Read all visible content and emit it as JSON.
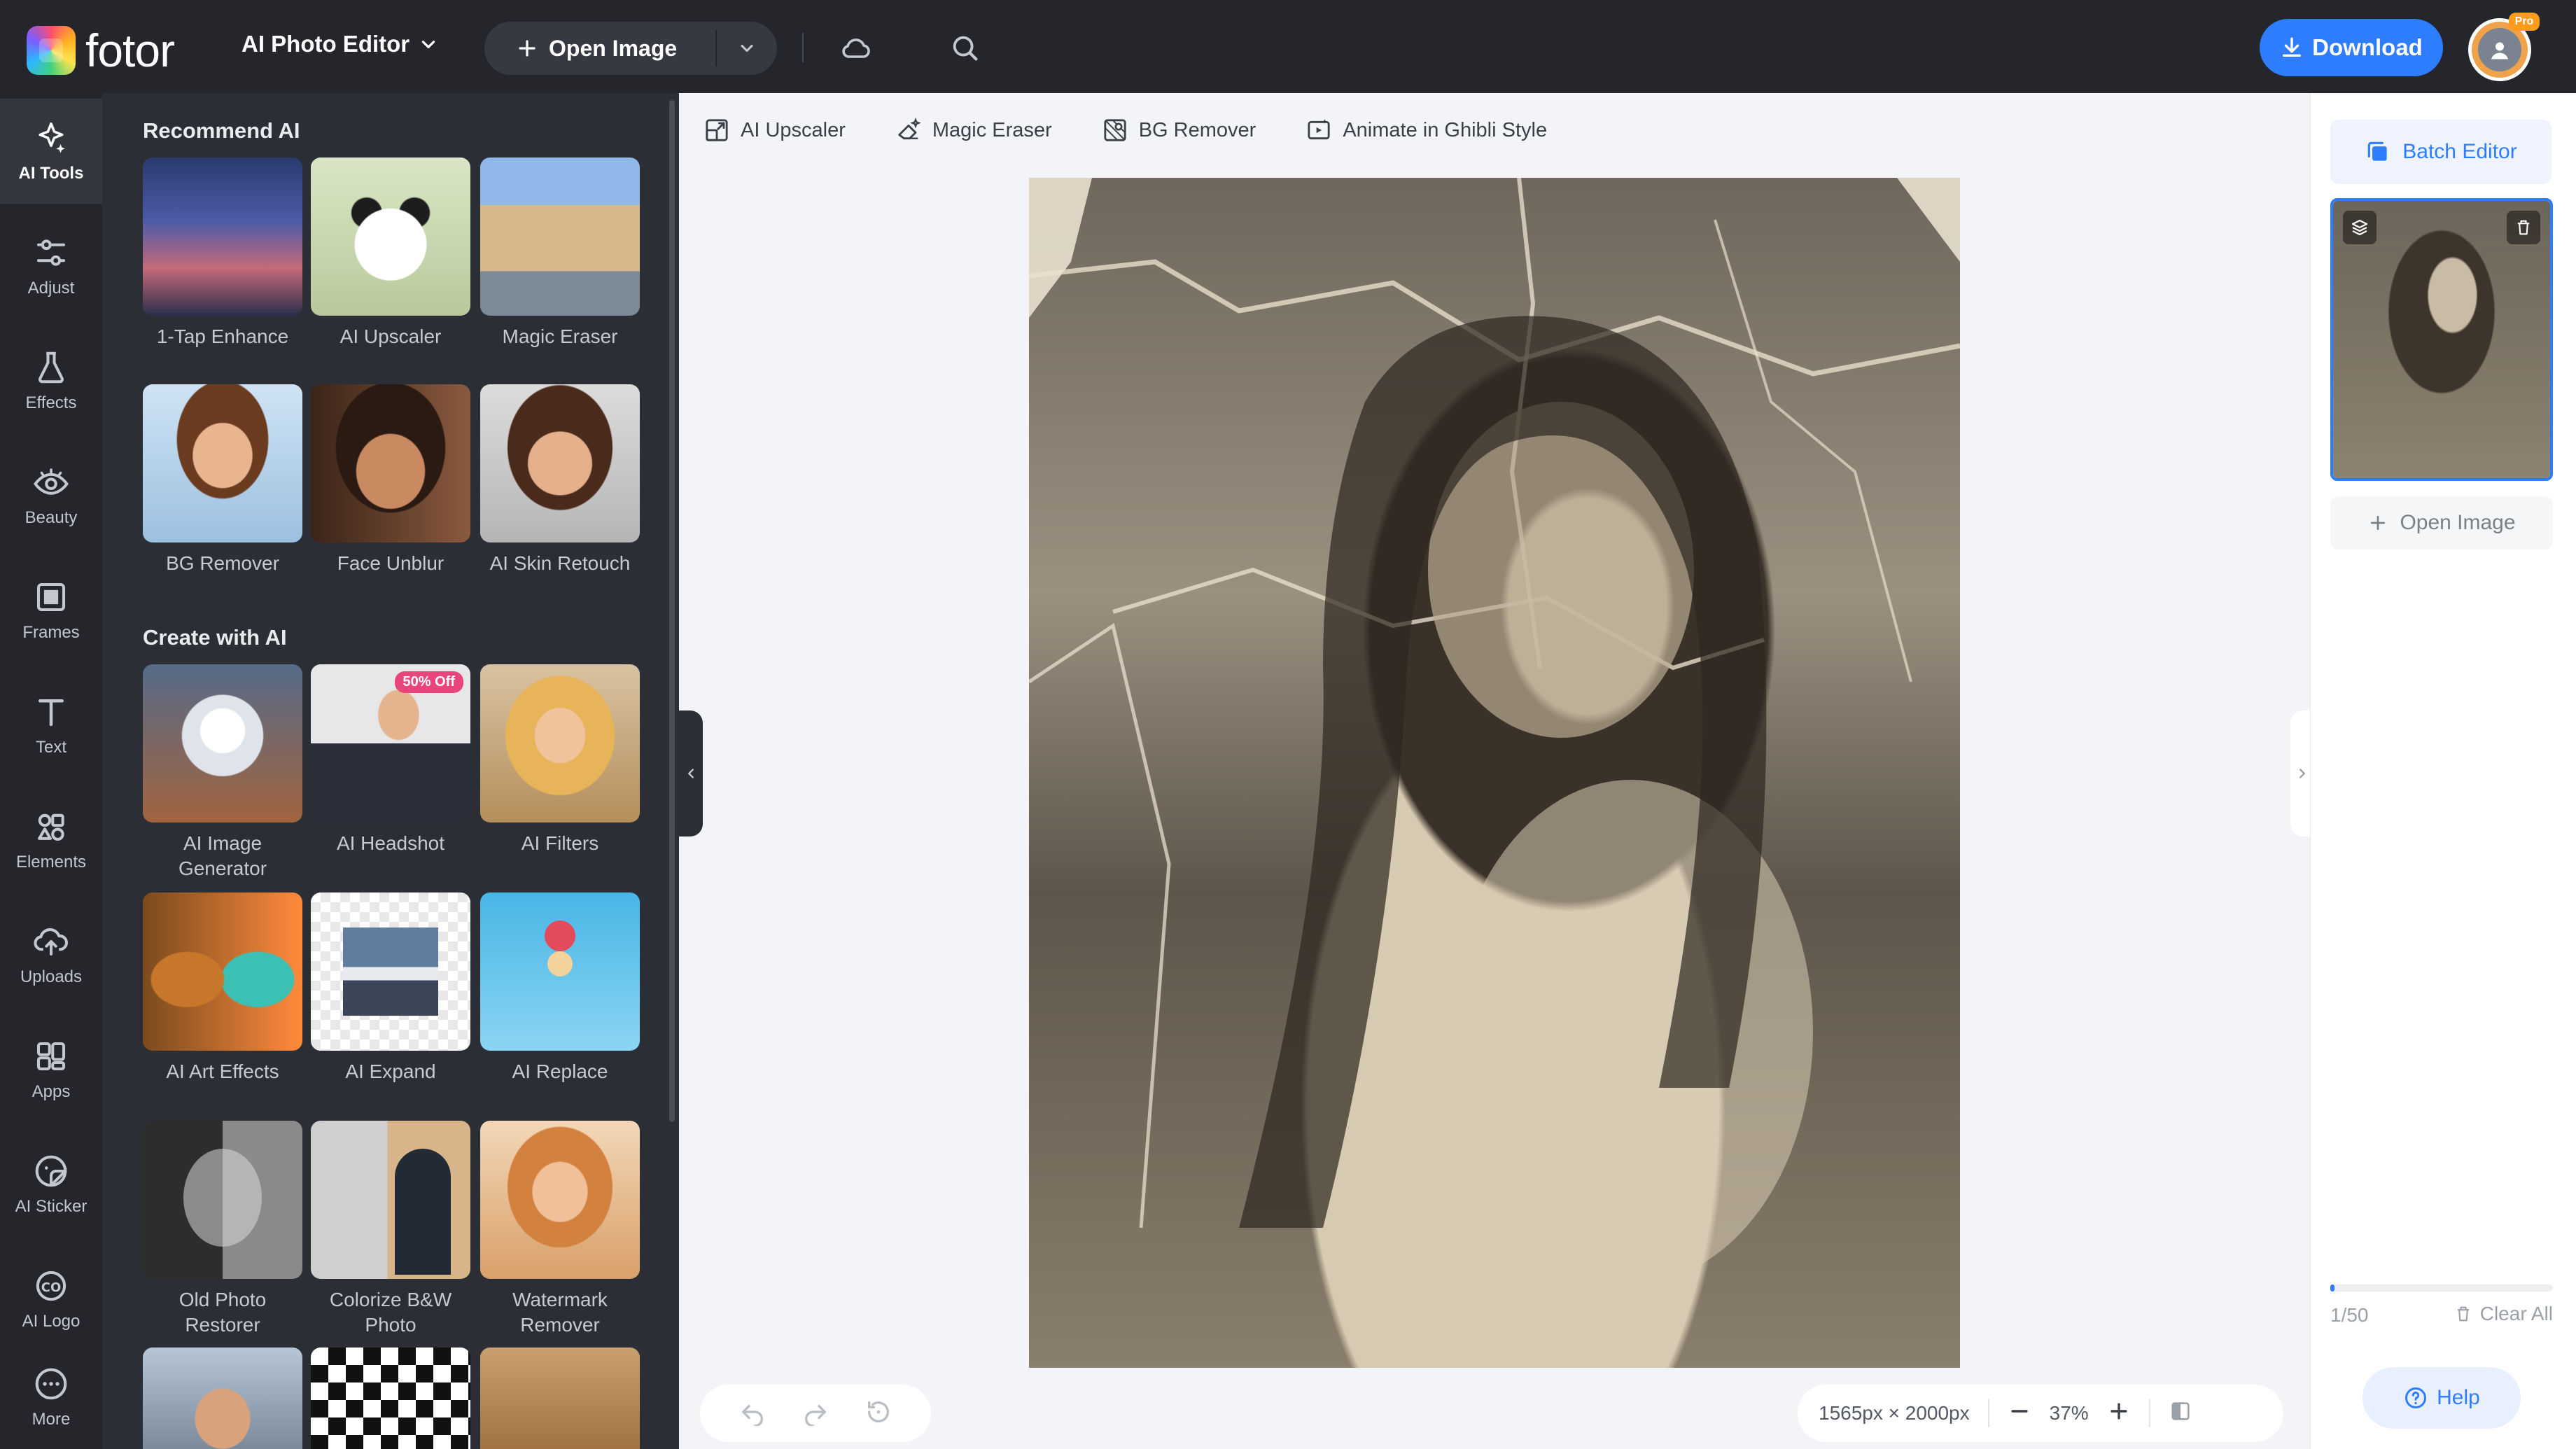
{
  "topbar": {
    "logo_text": "fotor",
    "product_menu": "AI Photo Editor",
    "open_image": "Open Image",
    "download": "Download",
    "pro_badge": "Pro"
  },
  "rail": {
    "items": [
      {
        "label": "AI Tools",
        "icon": "sparkle-icon"
      },
      {
        "label": "Adjust",
        "icon": "sliders-icon"
      },
      {
        "label": "Effects",
        "icon": "flask-icon"
      },
      {
        "label": "Beauty",
        "icon": "eye-icon"
      },
      {
        "label": "Frames",
        "icon": "frame-icon"
      },
      {
        "label": "Text",
        "icon": "text-icon"
      },
      {
        "label": "Elements",
        "icon": "shapes-icon"
      },
      {
        "label": "Uploads",
        "icon": "cloud-upload-icon"
      },
      {
        "label": "Apps",
        "icon": "apps-icon"
      },
      {
        "label": "AI Sticker",
        "icon": "sticker-icon"
      },
      {
        "label": "AI Logo",
        "icon": "logo-icon"
      },
      {
        "label": "More",
        "icon": "more-icon"
      }
    ]
  },
  "panel": {
    "recommend_title": "Recommend AI",
    "create_title": "Create with AI",
    "recommend": [
      {
        "label": "1-Tap Enhance"
      },
      {
        "label": "AI Upscaler"
      },
      {
        "label": "Magic Eraser"
      },
      {
        "label": "BG Remover"
      },
      {
        "label": "Face Unblur"
      },
      {
        "label": "AI Skin Retouch"
      }
    ],
    "create": [
      {
        "label": "AI Image Generator"
      },
      {
        "label": "AI Headshot",
        "badge": "50% Off"
      },
      {
        "label": "AI Filters"
      },
      {
        "label": "AI Art Effects"
      },
      {
        "label": "AI Expand"
      },
      {
        "label": "AI Replace"
      },
      {
        "label": "Old Photo Restorer"
      },
      {
        "label": "Colorize B&W Photo"
      },
      {
        "label": "Watermark Remover"
      }
    ]
  },
  "quickbar": {
    "items": [
      {
        "label": "AI Upscaler",
        "icon": "upscale-icon"
      },
      {
        "label": "Magic Eraser",
        "icon": "eraser-icon"
      },
      {
        "label": "BG Remover",
        "icon": "bg-remover-icon"
      },
      {
        "label": "Animate in Ghibli Style",
        "icon": "animate-icon"
      }
    ]
  },
  "canvas": {
    "dimensions": "1565px × 2000px",
    "zoom": "37%"
  },
  "rightbar": {
    "batch_editor": "Batch Editor",
    "open_image": "Open Image",
    "count": "1/50",
    "count_fraction": 0.02,
    "clear_all": "Clear All",
    "help": "Help"
  },
  "colors": {
    "accent": "#2f7dff",
    "dark_bg": "#24262c",
    "panel_bg": "#2b2e35",
    "badge": "#e8457a"
  }
}
